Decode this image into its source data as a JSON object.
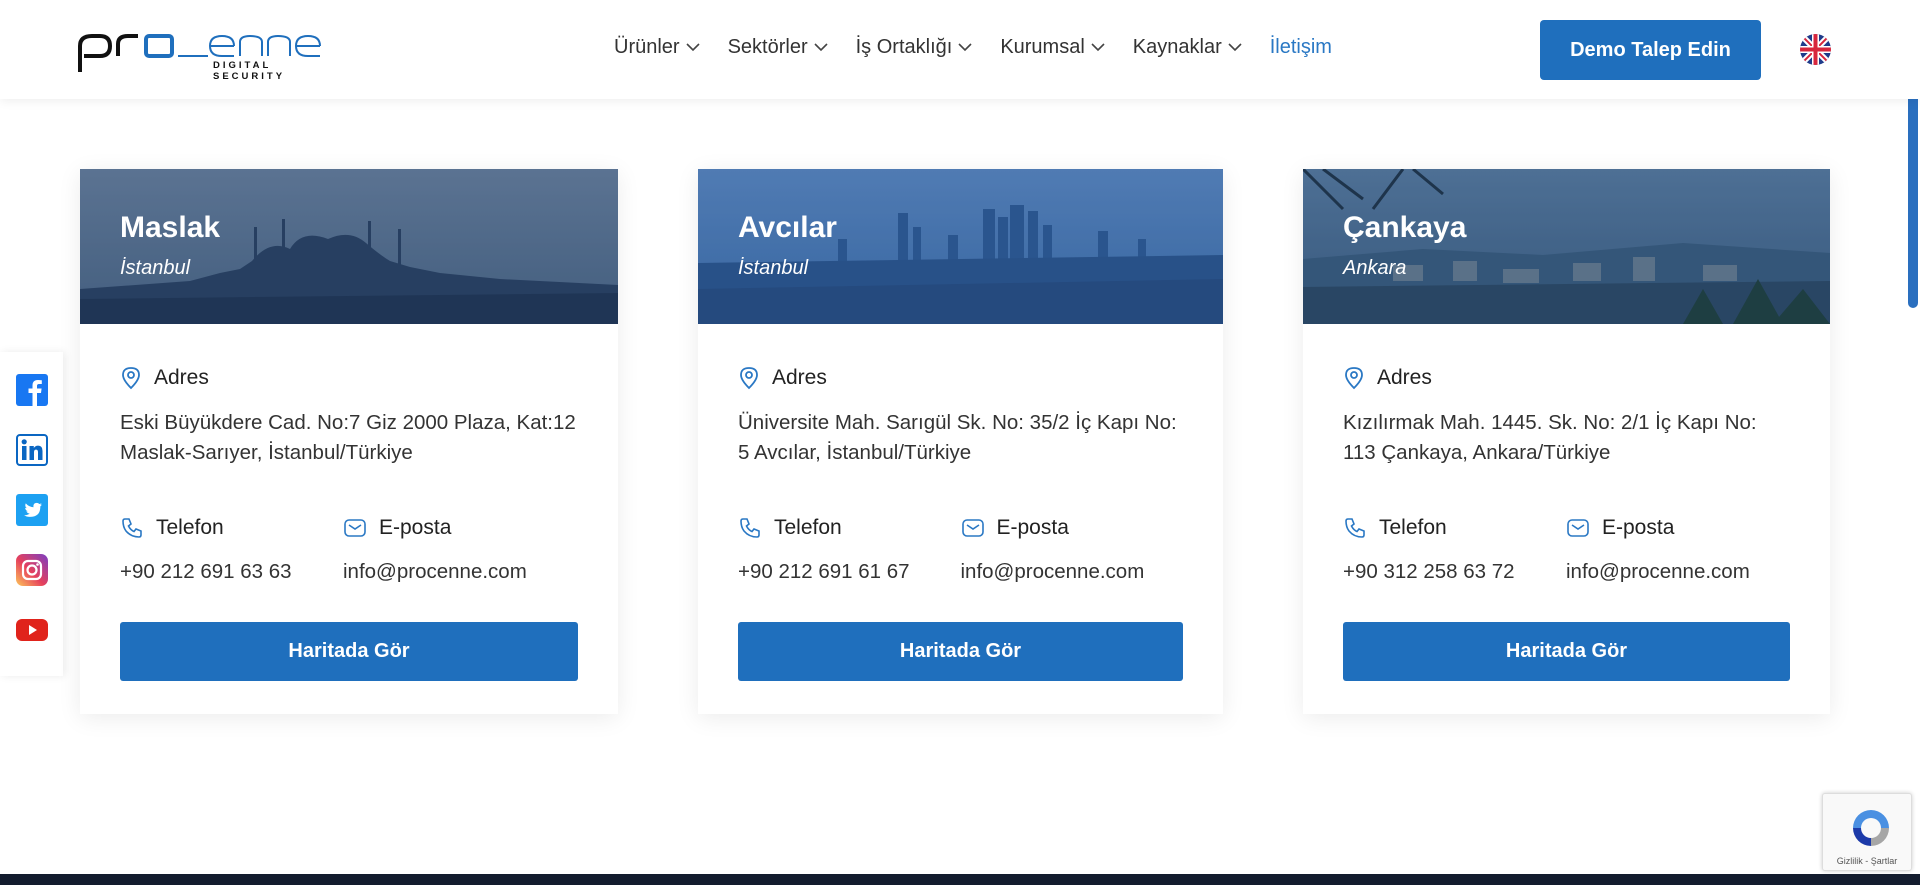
{
  "header": {
    "logo_text": "procenne",
    "logo_tagline": "DIGITAL SECURITY",
    "nav": [
      {
        "label": "Ürünler",
        "has_dropdown": true,
        "active": false
      },
      {
        "label": "Sektörler",
        "has_dropdown": true,
        "active": false
      },
      {
        "label": "İş Ortaklığı",
        "has_dropdown": true,
        "active": false
      },
      {
        "label": "Kurumsal",
        "has_dropdown": true,
        "active": false
      },
      {
        "label": "Kaynaklar",
        "has_dropdown": true,
        "active": false
      },
      {
        "label": "İletişim",
        "has_dropdown": false,
        "active": true
      }
    ],
    "demo_button": "Demo Talep Edin",
    "language_icon": "uk-flag-icon"
  },
  "social": [
    "facebook-icon",
    "linkedin-icon",
    "twitter-icon",
    "instagram-icon",
    "youtube-icon"
  ],
  "offices": [
    {
      "name": "Maslak",
      "city": "İstanbul",
      "address_label": "Adres",
      "address": "Eski Büyükdere Cad. No:7 Giz 2000 Plaza, Kat:12 Maslak-Sarıyer, İstanbul/Türkiye",
      "phone_label": "Telefon",
      "phone": "+90 212 691 63 63",
      "email_label": "E-posta",
      "email": "info@procenne.com",
      "button": "Haritada Gör"
    },
    {
      "name": "Avcılar",
      "city": "İstanbul",
      "address_label": "Adres",
      "address": "Üniversite Mah. Sarıgül Sk. No: 35/2 İç Kapı No: 5 Avcılar, İstanbul/Türkiye",
      "phone_label": "Telefon",
      "phone": "+90 212 691 61 67",
      "email_label": "E-posta",
      "email": "info@procenne.com",
      "button": "Haritada Gör"
    },
    {
      "name": "Çankaya",
      "city": "Ankara",
      "address_label": "Adres",
      "address": "Kızılırmak Mah. 1445. Sk. No: 2/1 İç Kapı No: 113 Çankaya, Ankara/Türkiye",
      "phone_label": "Telefon",
      "phone": "+90 312 258 63 72",
      "email_label": "E-posta",
      "email": "info@procenne.com",
      "button": "Haritada Gör"
    }
  ],
  "recaptcha": {
    "text": "Gizlilik - Şartlar"
  },
  "colors": {
    "primary": "#1f6fbd",
    "link_active": "#2a78c4",
    "footer": "#131c2e"
  }
}
